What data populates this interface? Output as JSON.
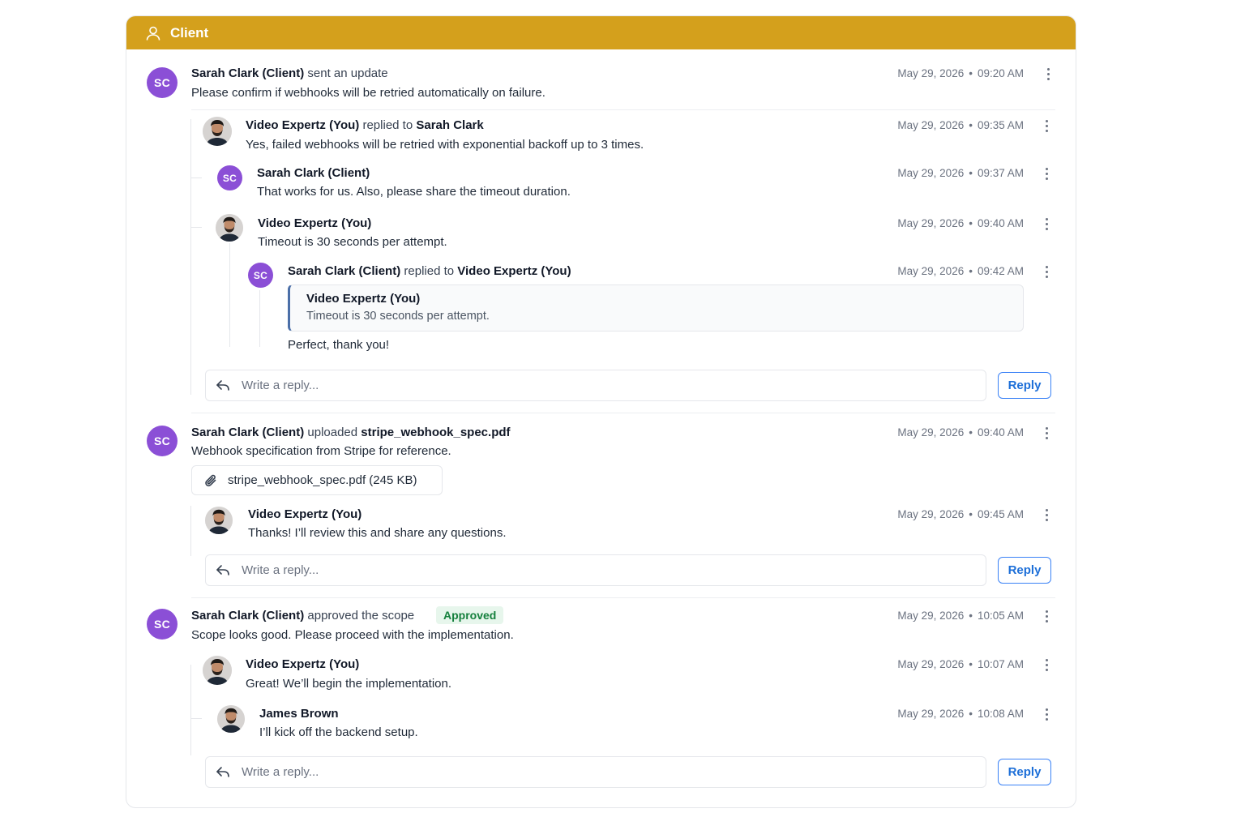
{
  "header": {
    "title": "Client",
    "icon": "user-icon",
    "color": "#d4a01c"
  },
  "threads": [
    {
      "author": "Sarah Clark (Client)",
      "action": "sent an update",
      "date": "May 29, 2026",
      "time": "09:20 AM",
      "text": "Please confirm if webhooks will be retried automatically on failure.",
      "avatar": "SC",
      "replies": [
        {
          "author": "Video Expertz (You)",
          "action": "replied to",
          "target": "Sarah Clark",
          "date": "May 29, 2026",
          "time": "09:35 AM",
          "text": "Yes, failed webhooks will be retried with exponential backoff up to 3 times."
        },
        {
          "author": "Sarah Clark (Client)",
          "avatar": "SC",
          "date": "May 29, 2026",
          "time": "09:37 AM",
          "text": "That works for us. Also, please share the timeout duration."
        },
        {
          "author": "Video Expertz (You)",
          "date": "May 29, 2026",
          "time": "09:40 AM",
          "text": "Timeout is 30 seconds per attempt."
        },
        {
          "author": "Sarah Clark (Client)",
          "action": "replied to",
          "target": "Video Expertz (You)",
          "avatar": "SC",
          "date": "May 29, 2026",
          "time": "09:42 AM",
          "quote": {
            "author": "Video Expertz (You)",
            "text": "Timeout is 30 seconds per attempt."
          },
          "text": "Perfect, thank you!"
        }
      ],
      "reply_placeholder": "Write a reply...",
      "reply_button": "Reply"
    },
    {
      "author": "Sarah Clark (Client)",
      "action": "uploaded",
      "target": "stripe_webhook_spec.pdf",
      "date": "May 29, 2026",
      "time": "09:40 AM",
      "text": "Webhook specification from Stripe for reference.",
      "avatar": "SC",
      "attachment": "stripe_webhook_spec.pdf (245 KB)",
      "replies": [
        {
          "author": "Video Expertz (You)",
          "date": "May 29, 2026",
          "time": "09:45 AM",
          "text": "Thanks! I’ll review this and share any questions."
        }
      ],
      "reply_placeholder": "Write a reply...",
      "reply_button": "Reply"
    },
    {
      "author": "Sarah Clark (Client)",
      "action": "approved the scope",
      "badge": "Approved",
      "date": "May 29, 2026",
      "time": "10:05 AM",
      "text": "Scope looks good. Please proceed with the implementation.",
      "avatar": "SC",
      "replies": [
        {
          "author": "Video Expertz (You)",
          "date": "May 29, 2026",
          "time": "10:07 AM",
          "text": "Great! We’ll begin the implementation."
        },
        {
          "author": "James Brown",
          "date": "May 29, 2026",
          "time": "10:08 AM",
          "text": "I’ll kick off the backend setup."
        }
      ],
      "reply_placeholder": "Write a reply...",
      "reply_button": "Reply"
    }
  ],
  "meta_separator": "•",
  "colors": {
    "avatar": "#8b4fd6",
    "reply_button": "#1d6fd8",
    "approved_badge": "#15803d",
    "quote_bar": "#4b6fa8"
  }
}
